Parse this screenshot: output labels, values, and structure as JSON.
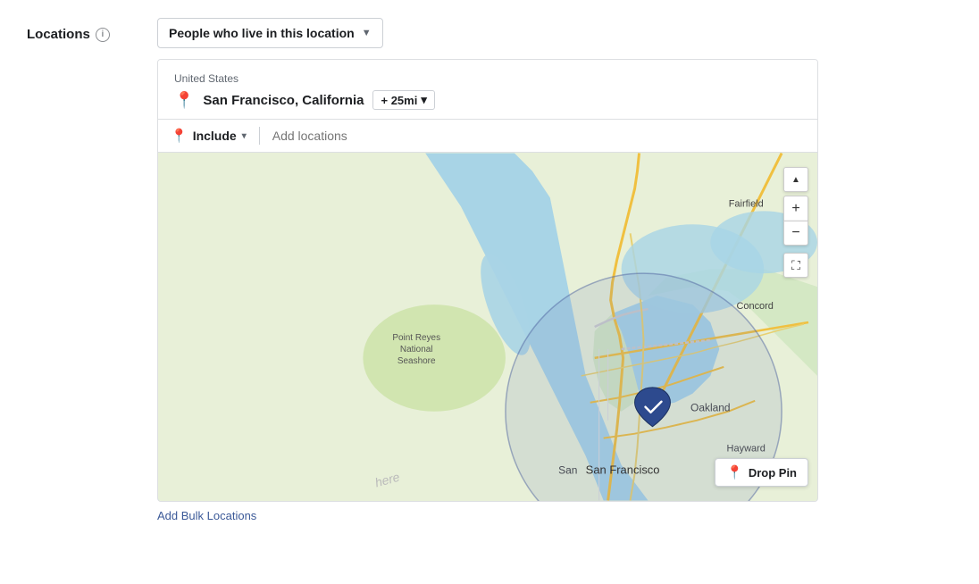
{
  "locations": {
    "label": "Locations",
    "info_icon": "i",
    "dropdown": {
      "label": "People who live in this location",
      "arrow": "▼"
    },
    "panel": {
      "country": "United States",
      "city": "San Francisco, California",
      "radius": "+ 25mi",
      "radius_arrow": "▾"
    },
    "include_bar": {
      "include_label": "Include",
      "include_arrow": "▾",
      "add_locations_placeholder": "Add locations"
    },
    "map_controls": {
      "zoom_in": "+",
      "zoom_out": "−",
      "fullscreen": "⛶",
      "up_arrow": "▲"
    },
    "drop_pin_btn": "Drop Pin",
    "add_bulk_link": "Add Bulk Locations"
  }
}
